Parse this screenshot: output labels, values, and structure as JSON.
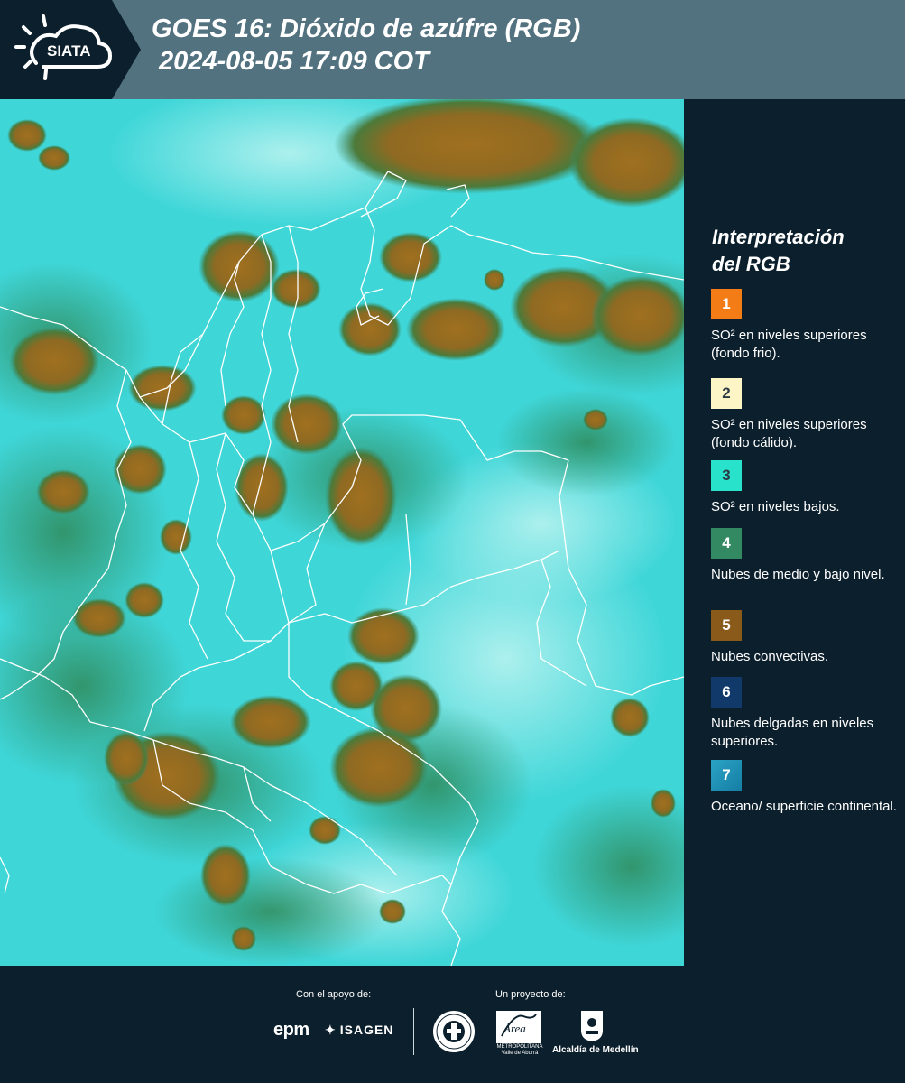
{
  "header": {
    "logo_text": "SIATA",
    "title_line1": "GOES 16: Dióxido de azúfre (RGB)",
    "title_line2": "2024-08-05 17:09 COT"
  },
  "legend": {
    "title_line1": "Interpretación",
    "title_line2": "del RGB",
    "items": [
      {
        "number": "1",
        "color": "#f47c16",
        "label": "SO² en niveles superiores (fondo frio)."
      },
      {
        "number": "2",
        "color": "#fdf5c6",
        "label": "SO² en niveles superiores (fondo cálido)."
      },
      {
        "number": "3",
        "color": "#28e2cc",
        "label": "SO² en niveles bajos."
      },
      {
        "number": "4",
        "color": "#338a62",
        "label": "Nubes de medio y bajo nivel."
      },
      {
        "number": "5",
        "color": "#8a5a1a",
        "label": "Nubes convectivas."
      },
      {
        "number": "6",
        "color": "#113a6a",
        "label": "Nubes delgadas en niveles superiores."
      },
      {
        "number": "7",
        "color": "#1d93b8",
        "label": "Oceano/ superficie continental."
      }
    ]
  },
  "map": {
    "background_color": "#3fd9d9",
    "cloud_color": "#9a6a1e",
    "mid_cloud_color": "#2f8a5a"
  },
  "footer": {
    "support_label": "Con el apoyo de:",
    "project_label": "Un proyecto de:",
    "epm": "epm",
    "isagen": "ISAGEN",
    "area_logo_text": "Área",
    "area_name": "METROPOLITANA Valle de Aburrá",
    "alcaldia": "Alcaldía de Medellín"
  }
}
